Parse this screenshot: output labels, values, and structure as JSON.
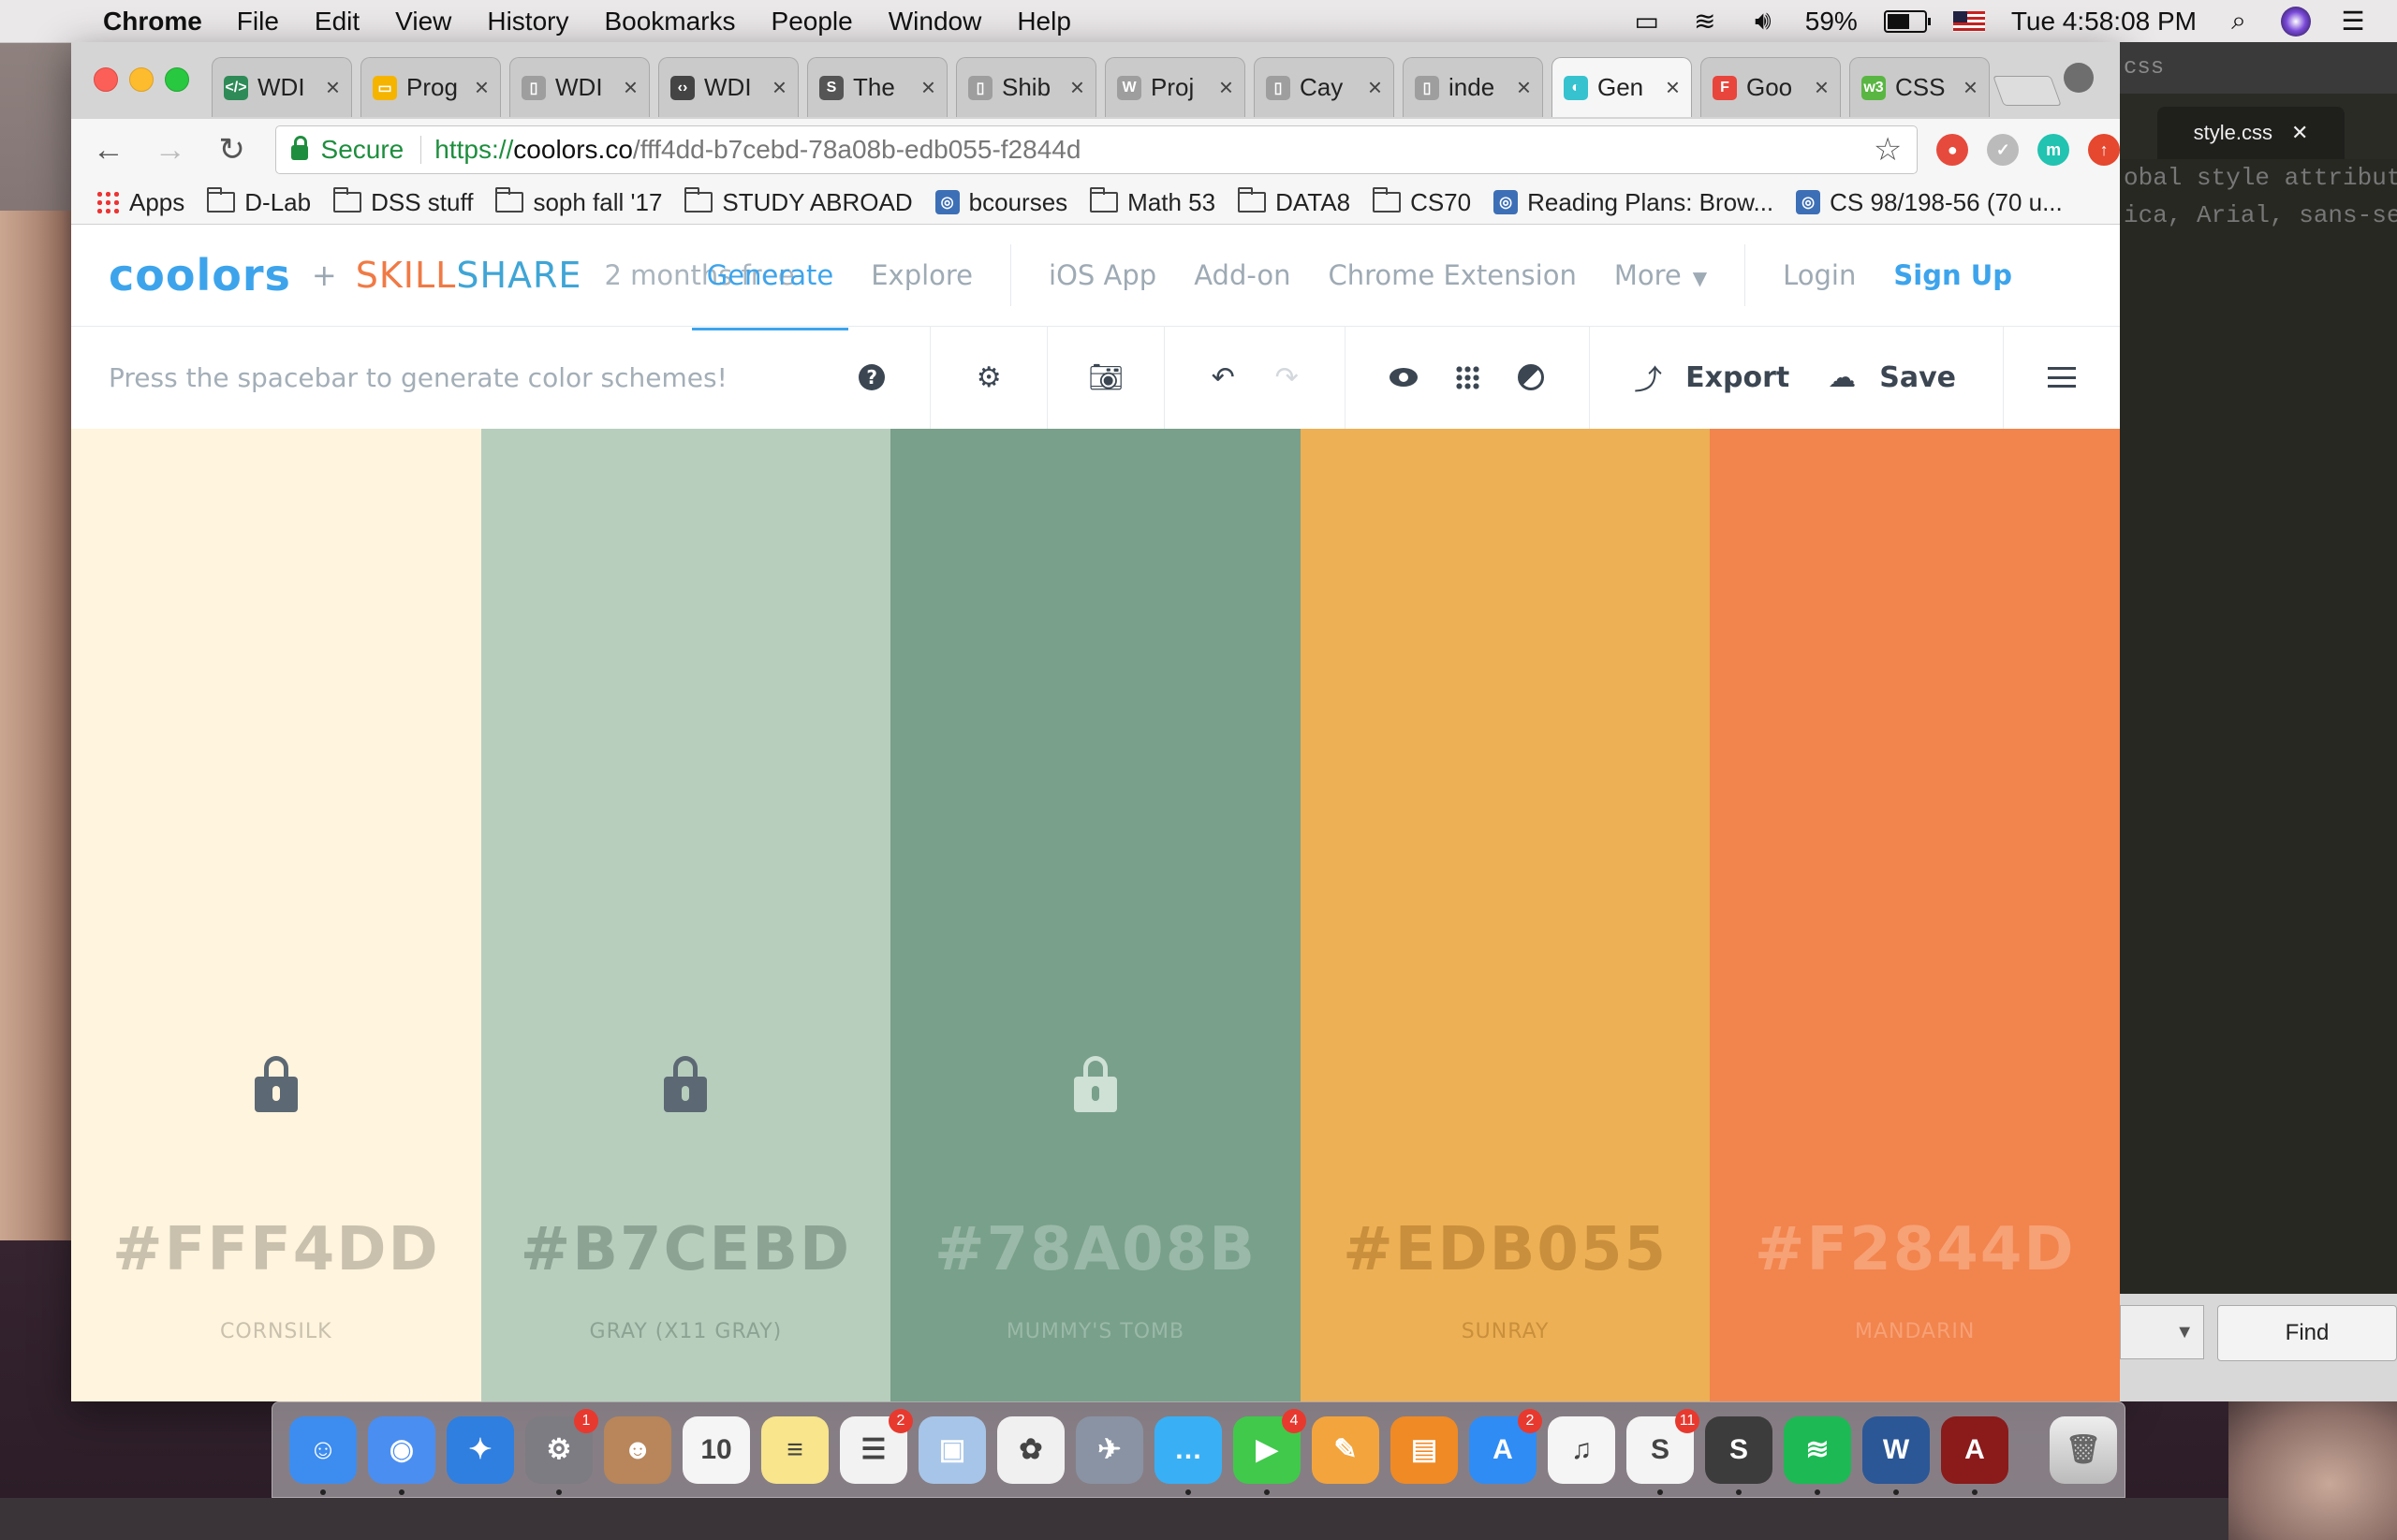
{
  "menubar": {
    "app": "Chrome",
    "items": [
      "File",
      "Edit",
      "View",
      "History",
      "Bookmarks",
      "People",
      "Window",
      "Help"
    ],
    "battery": "59%",
    "clock": "Tue 4:58:08 PM"
  },
  "tabs": [
    {
      "label": "WDI",
      "color": "#2e8b57",
      "glyph": "</>"
    },
    {
      "label": "Prog",
      "color": "#f4b400",
      "glyph": "▭"
    },
    {
      "label": "WDI",
      "color": "#9e9e9e",
      "glyph": "▯"
    },
    {
      "label": "WDI",
      "color": "#444444",
      "glyph": "‹›"
    },
    {
      "label": "The",
      "color": "#555555",
      "glyph": "S"
    },
    {
      "label": "Shib",
      "color": "#9e9e9e",
      "glyph": "▯"
    },
    {
      "label": "Proj",
      "color": "#9e9e9e",
      "glyph": "W"
    },
    {
      "label": "Cay",
      "color": "#9e9e9e",
      "glyph": "▯"
    },
    {
      "label": "inde",
      "color": "#9e9e9e",
      "glyph": "▯"
    },
    {
      "label": "Gen",
      "color": "#36c2cf",
      "glyph": "◐"
    },
    {
      "label": "Goo",
      "color": "#e8453c",
      "glyph": "F"
    },
    {
      "label": "CSS",
      "color": "#59b642",
      "glyph": "w3"
    }
  ],
  "omnibox": {
    "secure": "Secure",
    "scheme": "https://",
    "host": "coolors.co",
    "path": "/fff4dd-b7cebd-78a08b-edb055-f2844d"
  },
  "bookmarks": [
    {
      "label": "Apps",
      "kind": "apps"
    },
    {
      "label": "D-Lab",
      "kind": "folder"
    },
    {
      "label": "DSS stuff",
      "kind": "folder"
    },
    {
      "label": "soph fall '17",
      "kind": "folder"
    },
    {
      "label": "STUDY ABROAD",
      "kind": "folder"
    },
    {
      "label": "bcourses",
      "kind": "site"
    },
    {
      "label": "Math 53",
      "kind": "folder"
    },
    {
      "label": "DATA8",
      "kind": "folder"
    },
    {
      "label": "CS70",
      "kind": "folder"
    },
    {
      "label": "Reading Plans: Brow...",
      "kind": "site"
    },
    {
      "label": "CS 98/198-56 (70 u...",
      "kind": "site"
    }
  ],
  "site": {
    "logo": "coolors",
    "plus": "+",
    "partner_a": "SKILL",
    "partner_b": "SHARE",
    "promo": "2 months free",
    "nav": {
      "generate": "Generate",
      "explore": "Explore",
      "ios": "iOS App",
      "addon": "Add-on",
      "chrome_ext": "Chrome Extension",
      "more": "More",
      "login": "Login",
      "signup": "Sign Up"
    },
    "hint": "Press the spacebar to generate color schemes!",
    "export": "Export",
    "save": "Save"
  },
  "palette": [
    {
      "hex": "#FFF4DD",
      "name": "CORNSILK",
      "bg": "#fff4dd",
      "text": "#c9c0ad",
      "lock": "#5c6873"
    },
    {
      "hex": "#B7CEBD",
      "name": "GRAY (X11 GRAY)",
      "bg": "#b7cebd",
      "text": "#8ca293",
      "lock": "#5c6873"
    },
    {
      "hex": "#78A08B",
      "name": "MUMMY'S TOMB",
      "bg": "#78a08b",
      "text": "#9bb9a8",
      "lock": "#cfe0d5"
    },
    {
      "hex": "#EDB055",
      "name": "SUNRAY",
      "bg": "#edb055",
      "text": "#c98f3c",
      "lock": "#edb055"
    },
    {
      "hex": "#F2844D",
      "name": "MANDARIN",
      "bg": "#f2844d",
      "text": "#f7a176",
      "lock": "#f2844d"
    }
  ],
  "editor": {
    "top": "css",
    "tab": "style.css",
    "lines": [
      "obal style attributes",
      "ica, Arial, sans-seri"
    ],
    "find": "Find"
  },
  "dock": [
    {
      "name": "Finder",
      "color": "#3d8df0",
      "glyph": "☺",
      "badge": "",
      "running": true
    },
    {
      "name": "Chrome",
      "color": "#4b8ef1",
      "glyph": "◉",
      "badge": "",
      "running": true
    },
    {
      "name": "Safari",
      "color": "#2f7fe0",
      "glyph": "✦",
      "badge": "",
      "running": false
    },
    {
      "name": "System Preferences",
      "color": "#7c7c82",
      "glyph": "⚙",
      "badge": "1",
      "running": true
    },
    {
      "name": "Contacts",
      "color": "#b8865a",
      "glyph": "☻",
      "badge": "",
      "running": false
    },
    {
      "name": "Calendar",
      "color": "#f5f5f5",
      "glyph": "10",
      "badge": "",
      "running": false
    },
    {
      "name": "Notes",
      "color": "#f8e58c",
      "glyph": "≡",
      "badge": "",
      "running": false
    },
    {
      "name": "Reminders",
      "color": "#f2f2f2",
      "glyph": "☰",
      "badge": "2",
      "running": false
    },
    {
      "name": "Preview",
      "color": "#a7c5e8",
      "glyph": "▣",
      "badge": "",
      "running": false
    },
    {
      "name": "Photos",
      "color": "#f0f0f0",
      "glyph": "✿",
      "badge": "",
      "running": false
    },
    {
      "name": "Launchpad",
      "color": "#8a93a3",
      "glyph": "✈",
      "badge": "",
      "running": false
    },
    {
      "name": "Messages",
      "color": "#39b0f5",
      "glyph": "…",
      "badge": "",
      "running": true
    },
    {
      "name": "FaceTime",
      "color": "#41c94b",
      "glyph": "▶",
      "badge": "4",
      "running": true
    },
    {
      "name": "Pages",
      "color": "#f4a43c",
      "glyph": "✎",
      "badge": "",
      "running": false
    },
    {
      "name": "iBooks",
      "color": "#f08a24",
      "glyph": "▤",
      "badge": "",
      "running": false
    },
    {
      "name": "App Store",
      "color": "#2f8cf5",
      "glyph": "A",
      "badge": "2",
      "running": false
    },
    {
      "name": "iTunes",
      "color": "#f5f5f5",
      "glyph": "♫",
      "badge": "",
      "running": false
    },
    {
      "name": "Slack",
      "color": "#f4f4f4",
      "glyph": "S",
      "badge": "11",
      "running": true
    },
    {
      "name": "Sublime Text",
      "color": "#3c3c3c",
      "glyph": "S",
      "badge": "",
      "running": true
    },
    {
      "name": "Spotify",
      "color": "#1db954",
      "glyph": "≋",
      "badge": "",
      "running": true
    },
    {
      "name": "Word",
      "color": "#2b5797",
      "glyph": "W",
      "badge": "",
      "running": true
    },
    {
      "name": "Acrobat",
      "color": "#8b1a1a",
      "glyph": "A",
      "badge": "",
      "running": true
    }
  ]
}
